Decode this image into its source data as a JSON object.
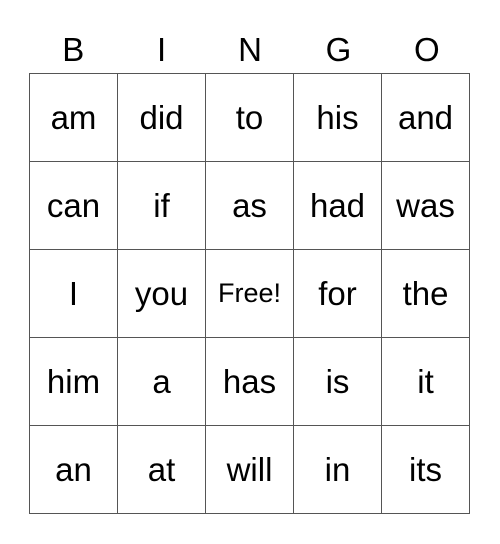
{
  "header": [
    "B",
    "I",
    "N",
    "G",
    "O"
  ],
  "cells": [
    [
      "am",
      "did",
      "to",
      "his",
      "and"
    ],
    [
      "can",
      "if",
      "as",
      "had",
      "was"
    ],
    [
      "I",
      "you",
      "Free!",
      "for",
      "the"
    ],
    [
      "him",
      "a",
      "has",
      "is",
      "it"
    ],
    [
      "an",
      "at",
      "will",
      "in",
      "its"
    ]
  ],
  "free_label": "Free!"
}
